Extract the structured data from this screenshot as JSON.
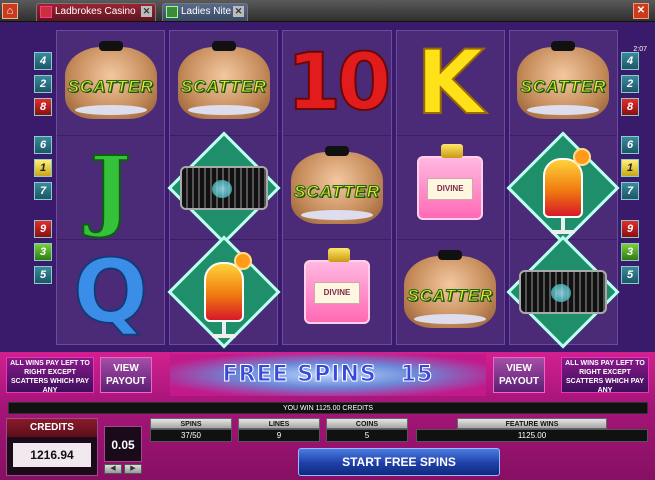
{
  "tabs": [
    {
      "label": "Ladbrokes Casino",
      "close": "✕"
    },
    {
      "label": "Ladies Nite",
      "close": "✕"
    }
  ],
  "window_close": "✕",
  "home_icon": "home-icon",
  "clock": "2:07",
  "paylines_left": [
    "4",
    "2",
    "8",
    "6",
    "1",
    "7",
    "9",
    "3",
    "5"
  ],
  "paylines_right": [
    "4",
    "2",
    "8",
    "6",
    "1",
    "7",
    "9",
    "3",
    "5"
  ],
  "reels": [
    [
      "scatter",
      "J",
      "Q"
    ],
    [
      "scatter",
      "glitter",
      "cocktail"
    ],
    [
      "10",
      "scatter",
      "perfume"
    ],
    [
      "K",
      "perfume",
      "scatter"
    ],
    [
      "scatter",
      "cocktail",
      "glitter"
    ]
  ],
  "symbols": {
    "scatter_word": "SCATTER",
    "perfume_label": "DIVINE"
  },
  "panel": {
    "info_text": "ALL WINS PAY LEFT TO RIGHT EXCEPT SCATTERS WHICH PAY ANY",
    "view_payout": "VIEW PAYOUT",
    "free_spins_label": "FREE SPINS",
    "free_spins_count": "15",
    "message": "YOU WIN 1125.00 CREDITS",
    "credits_label": "CREDITS",
    "credits_value": "1216.94",
    "coin_size": "0.05",
    "stats": [
      {
        "label": "SPINS",
        "value": "37/50"
      },
      {
        "label": "LINES",
        "value": "9"
      },
      {
        "label": "COINS",
        "value": "5"
      },
      {
        "label": "FEATURE WINS",
        "value": "1125.00"
      }
    ],
    "start_button": "START FREE SPINS"
  },
  "colors": {
    "accent": "#c0188a",
    "reel_bg": "#4b2a78",
    "button_blue": "#1f3fa8"
  }
}
